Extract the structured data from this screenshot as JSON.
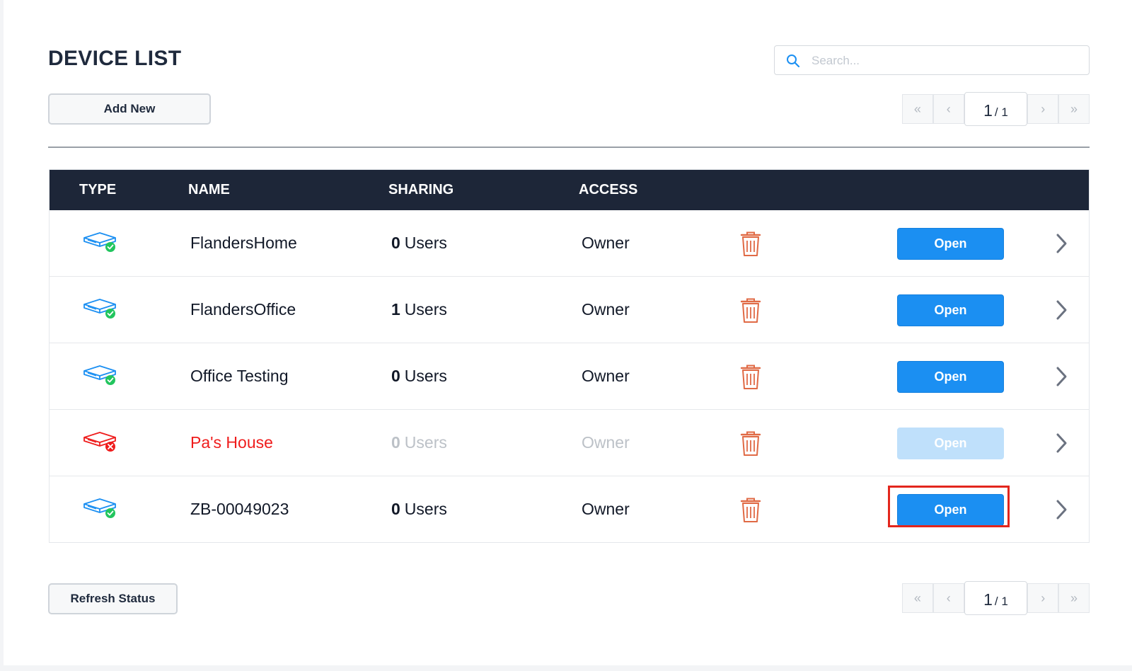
{
  "page": {
    "title": "DEVICE LIST"
  },
  "search": {
    "placeholder": "Search..."
  },
  "toolbar": {
    "add_new": "Add New",
    "refresh": "Refresh Status"
  },
  "pagination": {
    "first": "«",
    "prev": "‹",
    "current": "1",
    "total": "/ 1",
    "next": "›",
    "last": "»"
  },
  "table": {
    "headers": {
      "type": "TYPE",
      "name": "NAME",
      "sharing": "SHARING",
      "access": "ACCESS"
    },
    "rows": [
      {
        "name": "FlandersHome",
        "sharing_count": "0",
        "sharing_unit": "Users",
        "access": "Owner",
        "status": "online",
        "open": "Open"
      },
      {
        "name": "FlandersOffice",
        "sharing_count": "1",
        "sharing_unit": "Users",
        "access": "Owner",
        "status": "online",
        "open": "Open"
      },
      {
        "name": "Office Testing",
        "sharing_count": "0",
        "sharing_unit": "Users",
        "access": "Owner",
        "status": "online",
        "open": "Open"
      },
      {
        "name": "Pa's House",
        "sharing_count": "0",
        "sharing_unit": "Users",
        "access": "Owner",
        "status": "offline",
        "open": "Open"
      },
      {
        "name": "ZB-00049023",
        "sharing_count": "0",
        "sharing_unit": "Users",
        "access": "Owner",
        "status": "online",
        "open": "Open",
        "highlighted": true
      }
    ]
  },
  "colors": {
    "header_bg": "#1d2638",
    "primary_button": "#1b8ff2",
    "online_icon": "#1b8ff2",
    "offline_icon": "#ef1c1c",
    "trash_icon": "#e06a45",
    "status_ok": "#22c55e",
    "status_error": "#ef1c1c",
    "highlight_box": "#e3261d"
  },
  "icons": {
    "search": "search-icon",
    "device": "router-device-icon",
    "delete": "trash-icon",
    "row_details": "chevron-right-icon"
  }
}
